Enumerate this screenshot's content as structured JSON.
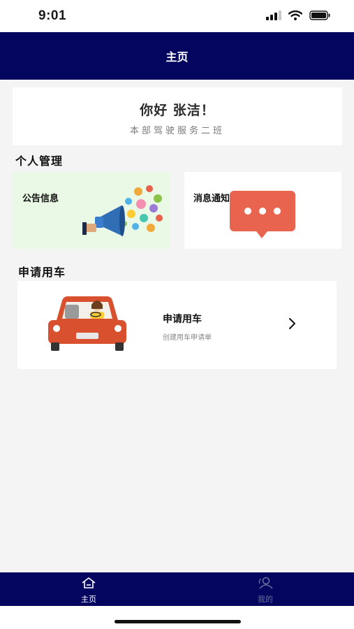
{
  "status_bar": {
    "time": "9:01"
  },
  "nav": {
    "title": "主页"
  },
  "greeting": {
    "text": "你好 张洁！",
    "subtitle": "本部驾驶服务二班"
  },
  "personal_section": {
    "title": "个人管理"
  },
  "notice_card": {
    "label": "公告信息"
  },
  "message_card": {
    "label": "消息通知"
  },
  "apply_section": {
    "title": "申请用车"
  },
  "apply_card": {
    "title": "申请用车",
    "description": "创建用车申请单"
  },
  "tabs": [
    {
      "label": "主页",
      "icon": "home-icon",
      "active": true
    },
    {
      "label": "我的",
      "icon": "user-icon",
      "active": false
    }
  ],
  "colors": {
    "nav_background": "#03055f",
    "notice_card_background": "#eaf8e6",
    "message_bubble": "#e9644f",
    "car_body": "#d9502f",
    "tab_active": "#ffffff",
    "tab_inactive": "#6a6f9a"
  }
}
